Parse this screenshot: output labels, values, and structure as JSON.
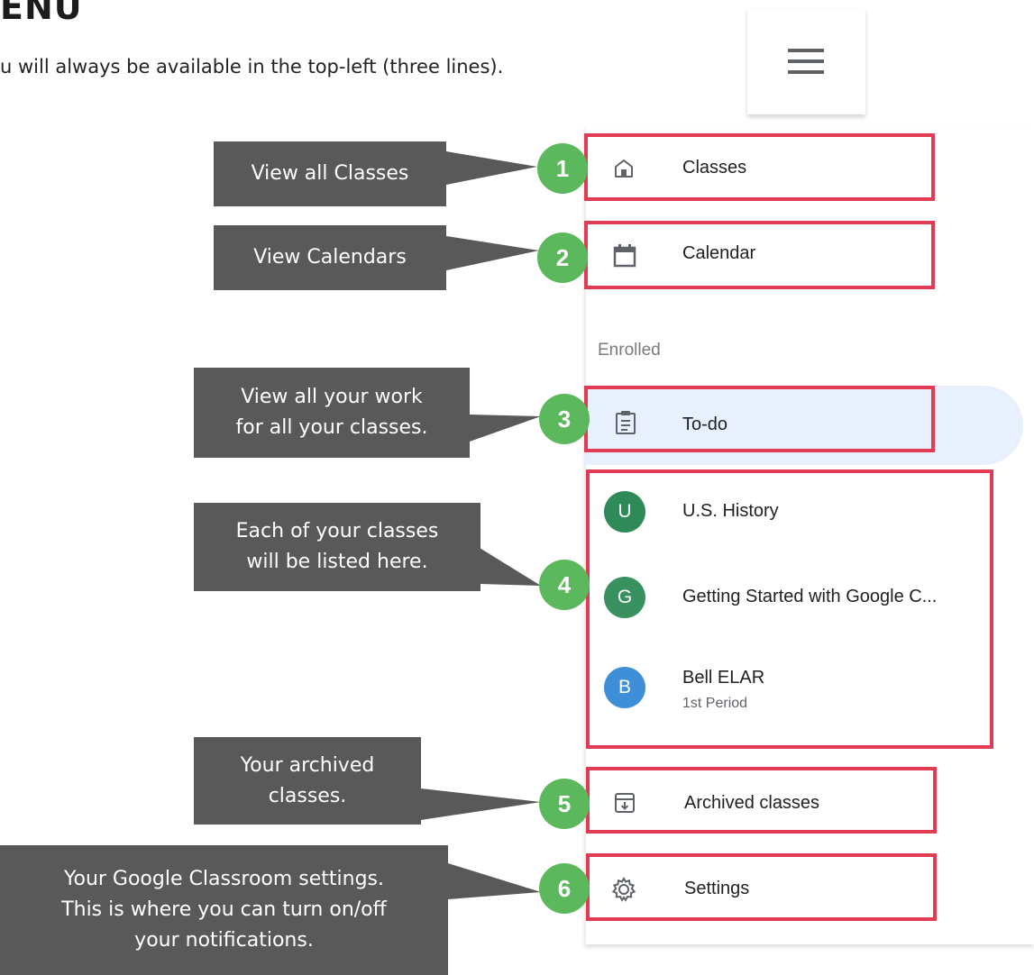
{
  "page": {
    "heading": "ENU",
    "subline": "u will always be available in the top-left (three lines)."
  },
  "menu_button": {
    "icon": "hamburger-menu-icon"
  },
  "drawer": {
    "items": [
      {
        "label": "Classes",
        "icon": "home-icon"
      },
      {
        "label": "Calendar",
        "icon": "calendar-icon"
      }
    ],
    "section_label": "Enrolled",
    "todo": {
      "label": "To-do",
      "icon": "clipboard-icon"
    },
    "classes": [
      {
        "initial": "U",
        "name": "U.S. History",
        "color": "#2e8b57"
      },
      {
        "initial": "G",
        "name": "Getting Started with Google C...",
        "color": "#3a9160"
      },
      {
        "initial": "B",
        "name": "Bell ELAR",
        "subtitle": "1st Period",
        "color": "#3f8fd8"
      }
    ],
    "archived": {
      "label": "Archived classes",
      "icon": "archive-icon"
    },
    "settings": {
      "label": "Settings",
      "icon": "gear-icon"
    }
  },
  "callouts": [
    {
      "number": "1",
      "text": "View all Classes"
    },
    {
      "number": "2",
      "text": "View Calendars"
    },
    {
      "number": "3",
      "line1": "View all your work",
      "line2": "for all  your classes."
    },
    {
      "number": "4",
      "line1": "Each of your classes",
      "line2": "will be listed here."
    },
    {
      "number": "5",
      "line1": "Your archived",
      "line2": "classes."
    },
    {
      "number": "6",
      "line1": "Your Google Classroom settings.",
      "line2": "This is where you can turn on/off",
      "line3": "your notifications."
    }
  ],
  "colors": {
    "highlight_border": "#e23b54",
    "badge": "#5cb85c",
    "callout_bg": "#595959",
    "todo_highlight": "#e8f0fe"
  }
}
